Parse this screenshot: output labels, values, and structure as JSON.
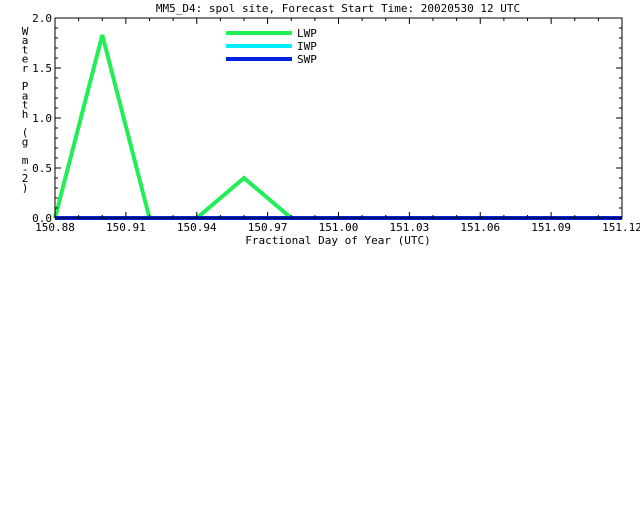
{
  "chart_data": {
    "type": "line",
    "title": "MM5_D4: spol site,  Forecast Start Time: 20020530 12 UTC",
    "xlabel": "Fractional Day of Year (UTC)",
    "ylabel": "Water Path (g m-2)",
    "ylabel_chars": [
      "W",
      "a",
      "t",
      "e",
      "r",
      " ",
      "P",
      "a",
      "t",
      "h",
      " ",
      "(",
      "g",
      " ",
      "m",
      "-",
      "2",
      ")"
    ],
    "xlim": [
      150.88,
      151.12
    ],
    "ylim": [
      0,
      2.0
    ],
    "x_ticks": [
      "150.88",
      "150.91",
      "150.94",
      "150.97",
      "151.00",
      "151.03",
      "151.06",
      "151.09",
      "151.12"
    ],
    "y_ticks": [
      "0.0",
      "0.5",
      "1.0",
      "1.5",
      "2.0"
    ],
    "grid": false,
    "legend_position": "top-center",
    "series": [
      {
        "name": "LWP",
        "color": "#22ee55",
        "x": [
          150.88,
          150.9,
          150.92,
          150.94,
          150.96,
          150.98,
          151.0,
          151.02,
          151.04,
          151.06,
          151.08,
          151.1,
          151.12
        ],
        "y": [
          0,
          1.83,
          0,
          0,
          0.4,
          0,
          0,
          0,
          0,
          0,
          0,
          0,
          0
        ]
      },
      {
        "name": "IWP",
        "color": "#00eeff",
        "x": [
          150.88,
          150.9,
          150.92,
          150.94,
          150.96,
          150.98,
          151.0,
          151.02,
          151.04,
          151.06,
          151.08,
          151.1,
          151.12
        ],
        "y": [
          0,
          0,
          0,
          0,
          0,
          0,
          0,
          0,
          0,
          0,
          0,
          0,
          0
        ]
      },
      {
        "name": "SWP",
        "color": "#0022dd",
        "x": [
          150.88,
          150.9,
          150.92,
          150.94,
          150.96,
          150.98,
          151.0,
          151.02,
          151.04,
          151.06,
          151.08,
          151.1,
          151.12
        ],
        "y": [
          0,
          0,
          0,
          0,
          0,
          0,
          0,
          0,
          0,
          0,
          0,
          0,
          0
        ]
      }
    ]
  }
}
